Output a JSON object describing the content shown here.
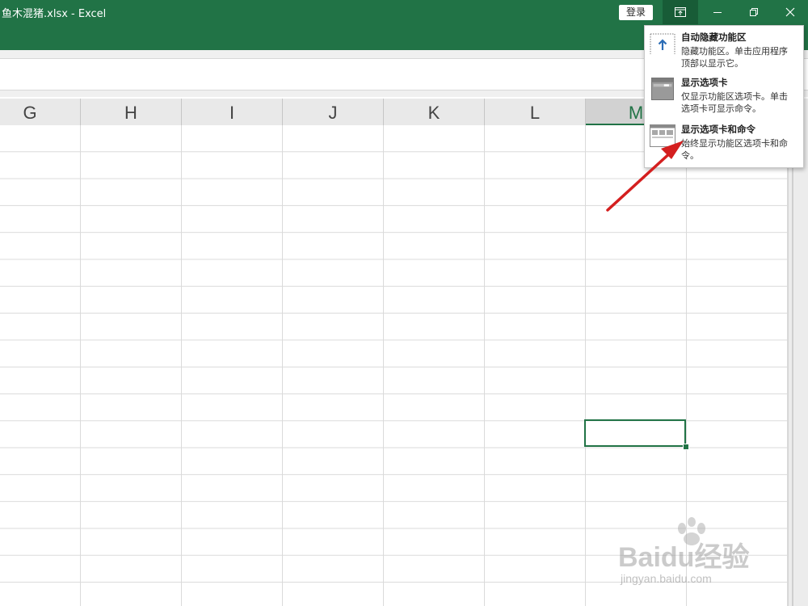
{
  "window": {
    "title": "鱼木混猪.xlsx  -  Excel",
    "login_label": "登录",
    "ribbon_display_icon": "ribbon-display-options-icon",
    "minimize_icon": "minimize-icon",
    "restore_icon": "restore-icon",
    "close_icon": "close-icon",
    "accent_color": "#217346"
  },
  "sheet": {
    "columns": [
      "G",
      "H",
      "I",
      "J",
      "K",
      "L",
      "M"
    ],
    "selected_column": "M"
  },
  "ribbon_menu": {
    "items": [
      {
        "title": "自动隐藏功能区",
        "desc": "隐藏功能区。单击应用程序顶部以显示它。",
        "icon": "auto-hide-ribbon-icon"
      },
      {
        "title": "显示选项卡",
        "desc": "仅显示功能区选项卡。单击选项卡可显示命令。",
        "icon": "show-tabs-icon"
      },
      {
        "title": "显示选项卡和命令",
        "desc": "始终显示功能区选项卡和命令。",
        "icon": "show-tabs-and-commands-icon"
      }
    ]
  },
  "watermark": {
    "logo_text": "Baidu经验",
    "url": "jingyan.baidu.com"
  }
}
